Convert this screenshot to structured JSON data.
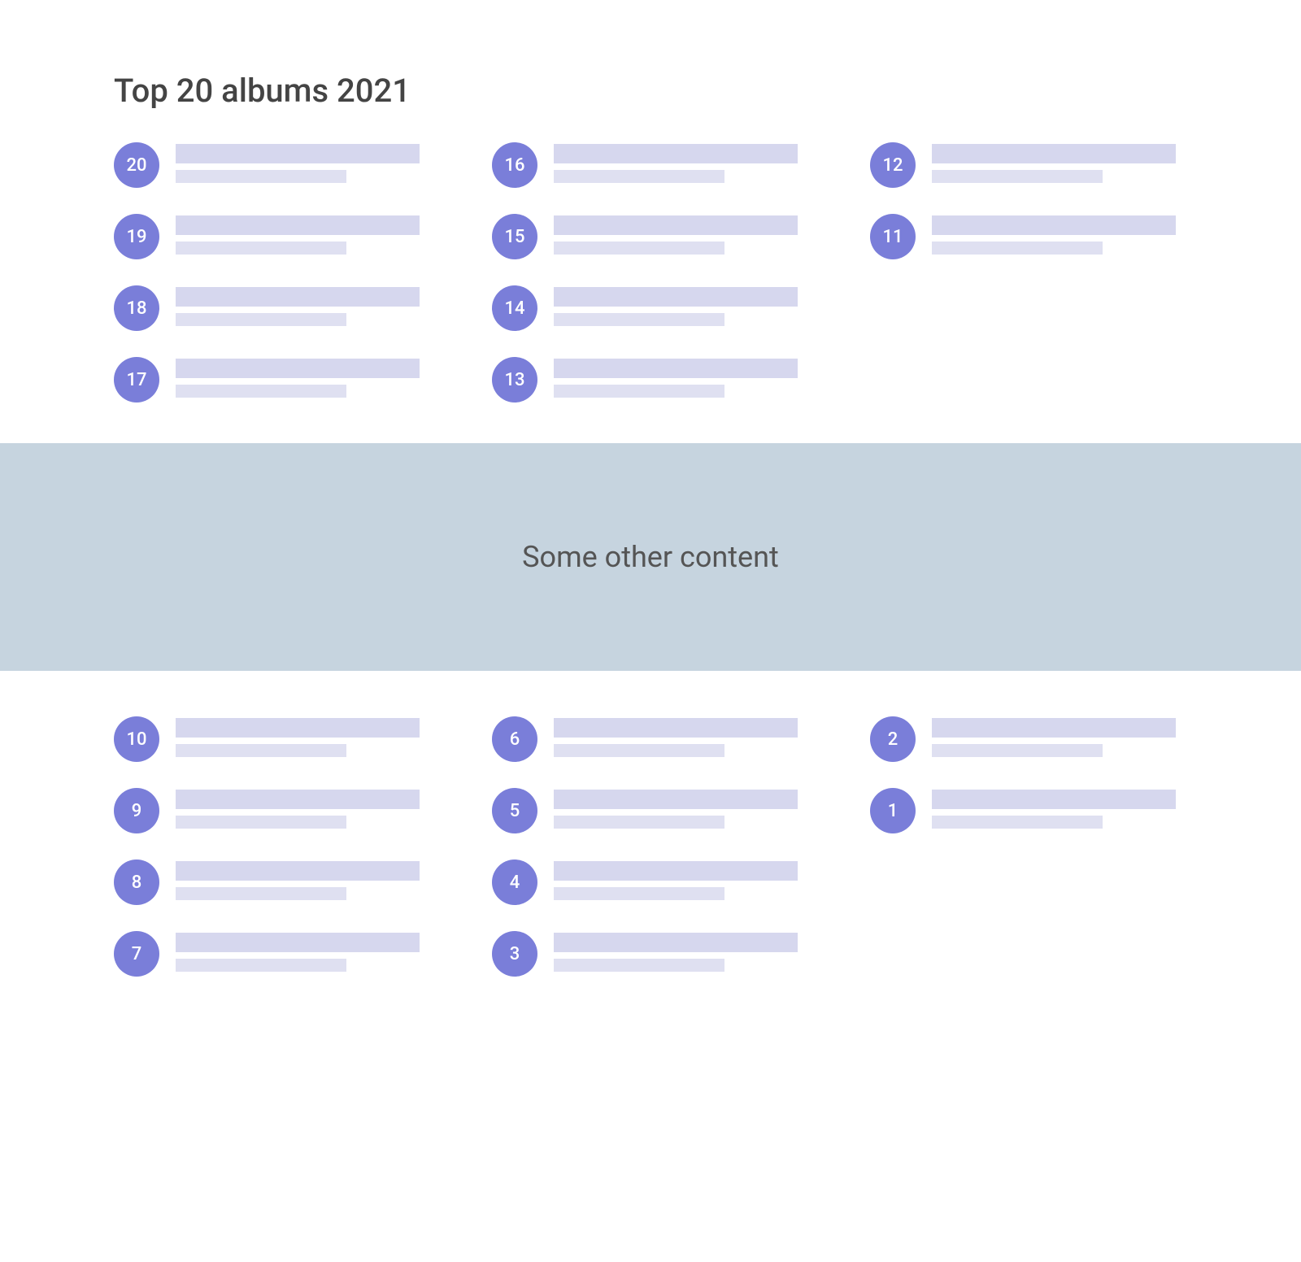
{
  "title": "Top 20 albums 2021",
  "banner": {
    "text": "Some other content"
  },
  "sections": [
    {
      "columns": [
        {
          "ranks": [
            20,
            19,
            18,
            17
          ]
        },
        {
          "ranks": [
            16,
            15,
            14,
            13
          ]
        },
        {
          "ranks": [
            12,
            11
          ]
        }
      ]
    },
    {
      "columns": [
        {
          "ranks": [
            10,
            9,
            8,
            7
          ]
        },
        {
          "ranks": [
            6,
            5,
            4,
            3
          ]
        },
        {
          "ranks": [
            2,
            1
          ]
        }
      ]
    }
  ]
}
